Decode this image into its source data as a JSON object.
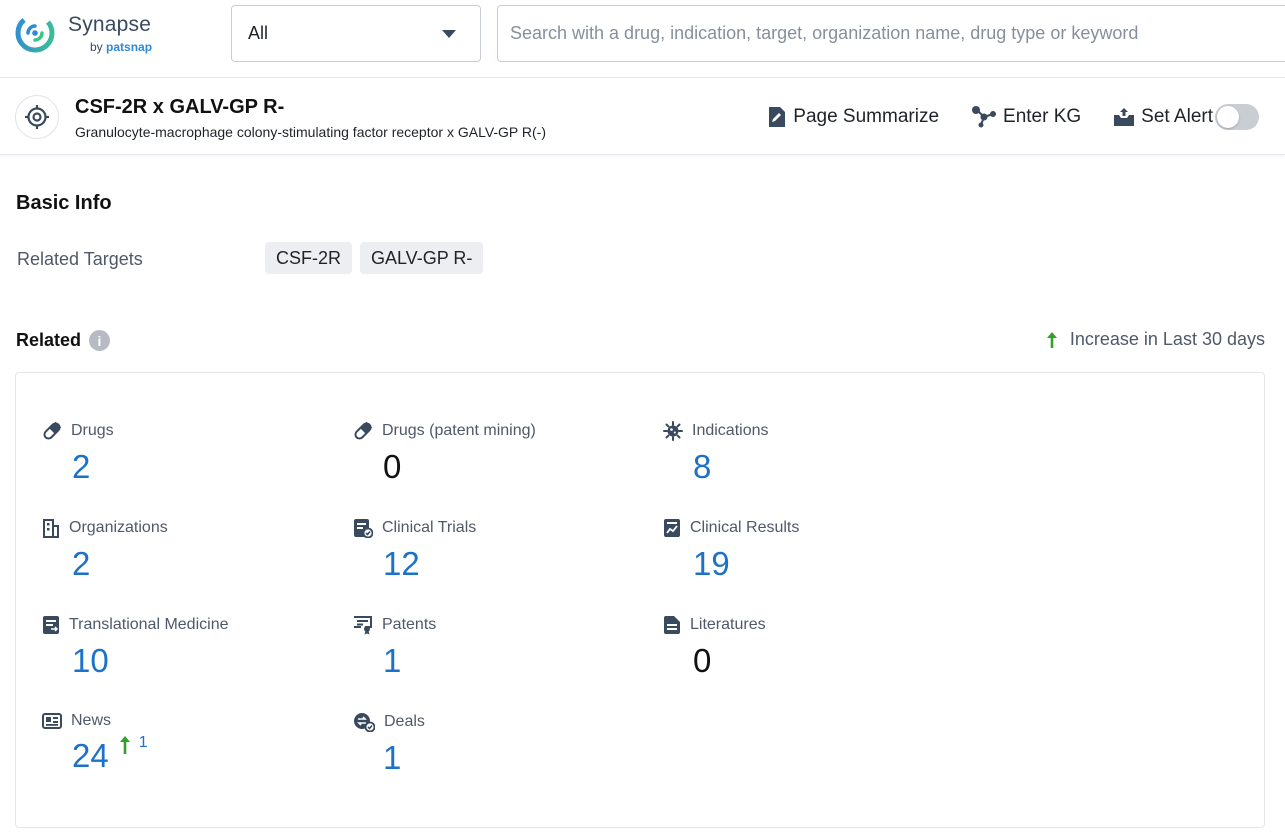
{
  "logo": {
    "name": "Synapse",
    "by": "by ",
    "brand": "patsnap"
  },
  "header": {
    "scope_value": "All",
    "search_placeholder": "Search with a drug, indication, target, organization name, drug type or keyword"
  },
  "title_bar": {
    "title": "CSF-2R x GALV-GP R-",
    "subtitle": "Granulocyte-macrophage colony-stimulating factor receptor x GALV-GP R(-)",
    "actions": {
      "page_summarize": "Page Summarize",
      "enter_kg": "Enter KG",
      "set_alert": "Set Alert"
    },
    "alert_enabled": false
  },
  "basic_info": {
    "heading": "Basic Info",
    "related_targets_label": "Related Targets",
    "targets": [
      "CSF-2R",
      "GALV-GP R-"
    ]
  },
  "related": {
    "heading": "Related",
    "info_glyph": "i",
    "increase_label": "Increase in Last 30 days",
    "stats": [
      {
        "label": "Drugs",
        "value": "2",
        "icon": "pill-icon"
      },
      {
        "label": "Drugs (patent mining)",
        "value": "0",
        "icon": "pill-icon"
      },
      {
        "label": "Indications",
        "value": "8",
        "icon": "virus-icon"
      },
      {
        "label": "Organizations",
        "value": "2",
        "icon": "building-icon"
      },
      {
        "label": "Clinical Trials",
        "value": "12",
        "icon": "clinical-trial-icon"
      },
      {
        "label": "Clinical Results",
        "value": "19",
        "icon": "chart-document-icon"
      },
      {
        "label": "Translational Medicine",
        "value": "10",
        "icon": "document-icon"
      },
      {
        "label": "Patents",
        "value": "1",
        "icon": "certificate-icon"
      },
      {
        "label": "Literatures",
        "value": "0",
        "icon": "literature-icon"
      },
      {
        "label": "News",
        "value": "24",
        "increase": "1",
        "icon": "newspaper-icon"
      },
      {
        "label": "Deals",
        "value": "1",
        "icon": "deal-icon"
      }
    ]
  },
  "colors": {
    "link_blue": "#1b72c8",
    "increase_green": "#34a02c",
    "brand_teal": "#2bb59a",
    "brand_blue": "#2f88d8"
  }
}
